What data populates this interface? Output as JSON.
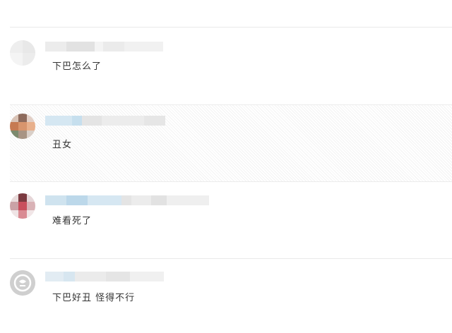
{
  "comments": [
    {
      "text": "下巴怎么了"
    },
    {
      "text": "丑女"
    },
    {
      "text": "难看死了"
    },
    {
      "text": "下巴好丑  怪得不行"
    }
  ],
  "colors": {
    "divider": "#e9e9e9",
    "text": "#333333",
    "blurred_name_gray": "#e6e6e6",
    "blurred_name_blue": "#cfe3ef"
  }
}
